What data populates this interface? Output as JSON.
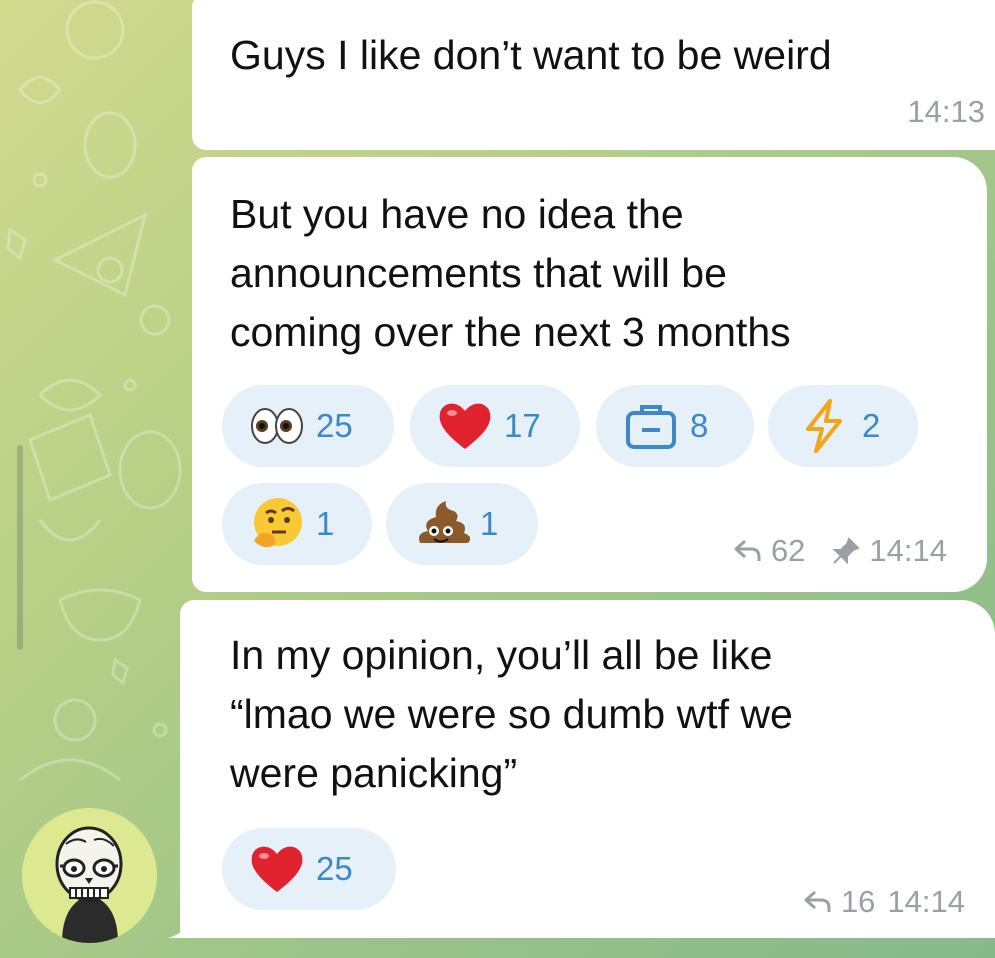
{
  "messages": [
    {
      "text": "Guys I like don’t want to be weird",
      "time": "14:13"
    },
    {
      "text_lines": [
        "But you have no idea the",
        "announcements that will be",
        "coming over the next 3 months"
      ],
      "reactions": [
        {
          "emoji": "eyes-emoji",
          "count": "25"
        },
        {
          "emoji": "heart-emoji",
          "count": "17"
        },
        {
          "emoji": "briefcase-emoji",
          "count": "8"
        },
        {
          "emoji": "lightning-emoji",
          "count": "2"
        },
        {
          "emoji": "thinking-face-emoji",
          "count": "1"
        },
        {
          "emoji": "poop-emoji",
          "count": "1"
        }
      ],
      "shares": "62",
      "pinned": true,
      "time": "14:14"
    },
    {
      "text_lines": [
        "In my opinion, you’ll all be like",
        "“lmao we were so dumb wtf we",
        "were panicking”"
      ],
      "reactions": [
        {
          "emoji": "heart-emoji",
          "count": "25"
        }
      ],
      "shares": "16",
      "time": "14:14"
    }
  ],
  "colors": {
    "reaction_bg": "#e6f0f9",
    "reaction_count": "#3d88c8",
    "meta": "#9aa0a6",
    "heart": "#e0232e"
  },
  "avatar": {
    "icon": "skull-avatar-icon"
  }
}
